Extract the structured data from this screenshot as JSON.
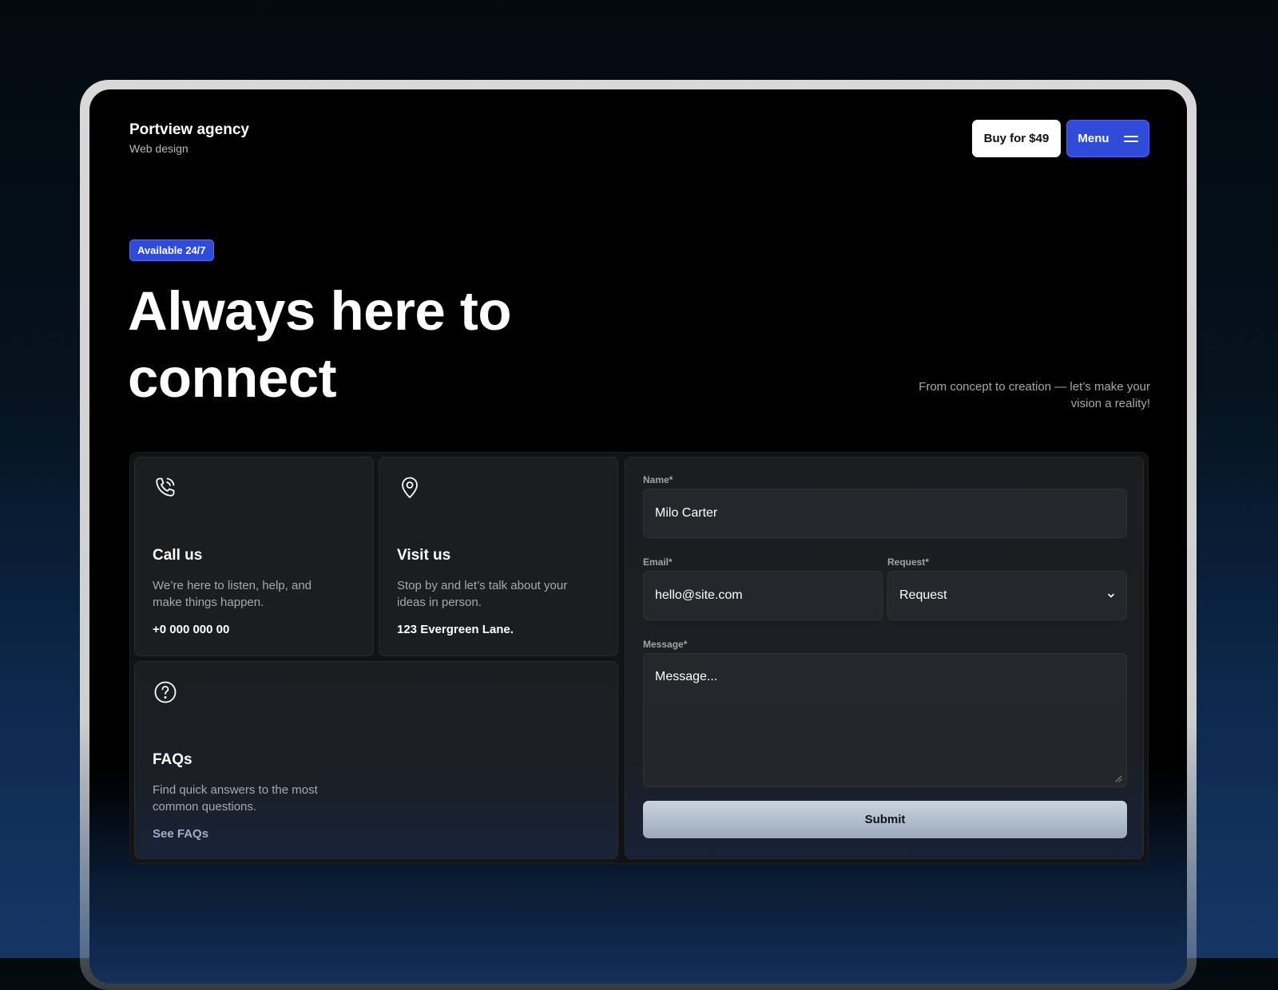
{
  "header": {
    "brand_name": "Portview agency",
    "brand_sub": "Web design",
    "buy_label": "Buy for $49",
    "menu_label": "Menu"
  },
  "hero": {
    "badge": "Available 24/7",
    "headline_line1": "Always here to",
    "headline_line2": "connect",
    "tagline_line1": "From concept to creation — let’s make your",
    "tagline_line2": "vision a reality!"
  },
  "cards": [
    {
      "icon": "phone-icon",
      "title": "Call us",
      "desc_line1": "We’re here to listen, help, and",
      "desc_line2": "make things happen.",
      "link": "+0 000 000 00"
    },
    {
      "icon": "map-pin-icon",
      "title": "Visit us",
      "desc_line1": "Stop by and let’s talk about your",
      "desc_line2": "ideas in person.",
      "link": "123 Evergreen Lane."
    },
    {
      "icon": "question-circle-icon",
      "title": "FAQs",
      "desc_line1": "Find quick answers to the most",
      "desc_line2": "common questions.",
      "link": "See FAQs"
    }
  ],
  "form": {
    "name_label": "Name*",
    "name_value": "Milo Carter",
    "email_label": "Email*",
    "email_value": "hello@site.com",
    "request_label": "Request*",
    "request_value": "Request",
    "message_label": "Message*",
    "message_placeholder": "Message...",
    "submit_label": "Submit"
  },
  "colors": {
    "accent": "#2f4bd8",
    "background_top": "#03090f",
    "background_bottom": "#163766",
    "card": "#1c1d1f",
    "submit": "#b4c0cf"
  }
}
